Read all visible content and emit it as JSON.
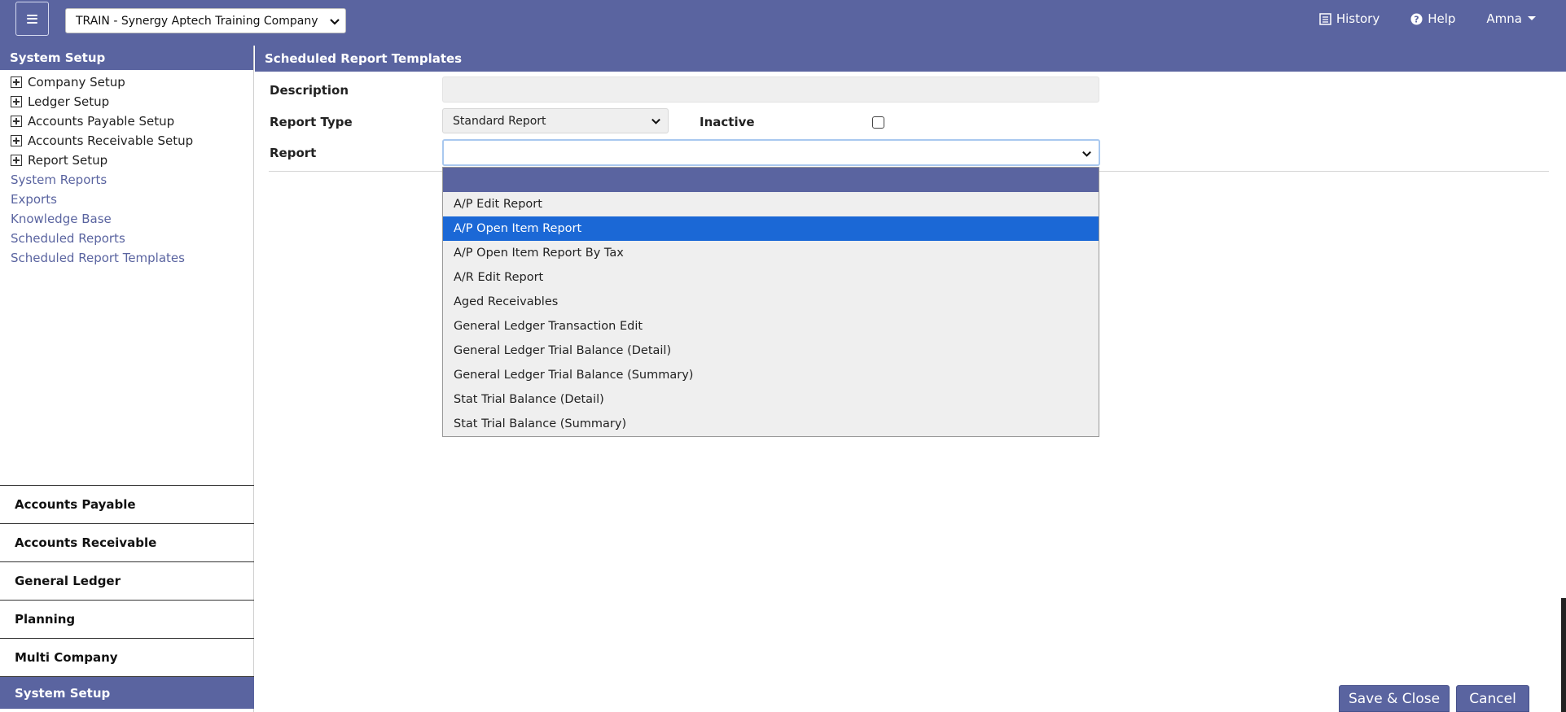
{
  "header": {
    "company": "TRAIN - Synergy Aptech Training Company",
    "history_label": "History",
    "help_label": "Help",
    "user_label": "Amna"
  },
  "sidebar": {
    "title": "System Setup",
    "tree_items": [
      {
        "label": "Company Setup"
      },
      {
        "label": "Ledger Setup"
      },
      {
        "label": "Accounts Payable Setup"
      },
      {
        "label": "Accounts Receivable Setup"
      },
      {
        "label": "Report Setup"
      }
    ],
    "links": [
      {
        "label": "System Reports"
      },
      {
        "label": "Exports"
      },
      {
        "label": "Knowledge Base"
      },
      {
        "label": "Scheduled Reports"
      },
      {
        "label": "Scheduled Report Templates"
      }
    ],
    "modules": [
      {
        "label": "Accounts Payable"
      },
      {
        "label": "Accounts Receivable"
      },
      {
        "label": "General Ledger"
      },
      {
        "label": "Planning"
      },
      {
        "label": "Multi Company"
      },
      {
        "label": "System Setup"
      }
    ]
  },
  "main": {
    "title": "Scheduled Report Templates",
    "form": {
      "description_label": "Description",
      "description_value": "",
      "report_type_label": "Report Type",
      "report_type_value": "Standard Report",
      "inactive_label": "Inactive",
      "report_label": "Report",
      "report_value": ""
    },
    "report_options": [
      {
        "label": "A/P Edit Report"
      },
      {
        "label": "A/P Open Item Report"
      },
      {
        "label": "A/P Open Item Report By Tax"
      },
      {
        "label": "A/R Edit Report"
      },
      {
        "label": "Aged Receivables"
      },
      {
        "label": "General Ledger Transaction Edit"
      },
      {
        "label": "General Ledger Trial Balance (Detail)"
      },
      {
        "label": "General Ledger Trial Balance (Summary)"
      },
      {
        "label": "Stat Trial Balance (Detail)"
      },
      {
        "label": "Stat Trial Balance (Summary)"
      }
    ],
    "highlighted_option": "A/P Open Item Report",
    "save_close_label": "Save & Close",
    "cancel_label": "Cancel"
  },
  "colors": {
    "brand": "#5a64a0",
    "highlight": "#1b68d6"
  }
}
